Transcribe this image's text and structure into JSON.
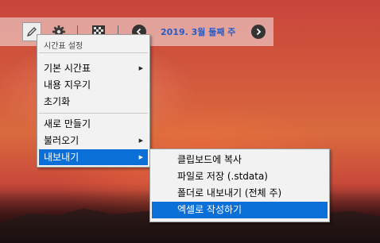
{
  "toolbar": {
    "icons": [
      "pencil-icon",
      "gear-icon",
      "grid-icon"
    ],
    "prev_icon": "chevron-left-icon",
    "next_icon": "chevron-right-icon",
    "week_label": "2019. 3월 둘째 주"
  },
  "menu": {
    "title": "시간표 설정",
    "items": [
      {
        "label": "기본 시간표",
        "submenu": true
      },
      {
        "label": "내용 지우기",
        "submenu": false
      },
      {
        "label": "초기화",
        "submenu": false
      },
      {
        "label": "새로 만들기",
        "submenu": false
      },
      {
        "label": "불러오기",
        "submenu": true
      },
      {
        "label": "내보내기",
        "submenu": true,
        "active": true
      }
    ],
    "arrow": "▶"
  },
  "submenu": {
    "items": [
      {
        "label": "클립보드에 복사"
      },
      {
        "label": "파일로 저장 (.stdata)"
      },
      {
        "label": "폴더로 내보내기 (전체 주)"
      },
      {
        "label": "엑셀로 작성하기",
        "active": true
      }
    ]
  },
  "colors": {
    "accent": "#0a6fd6",
    "week_text": "#2a5bc4"
  }
}
